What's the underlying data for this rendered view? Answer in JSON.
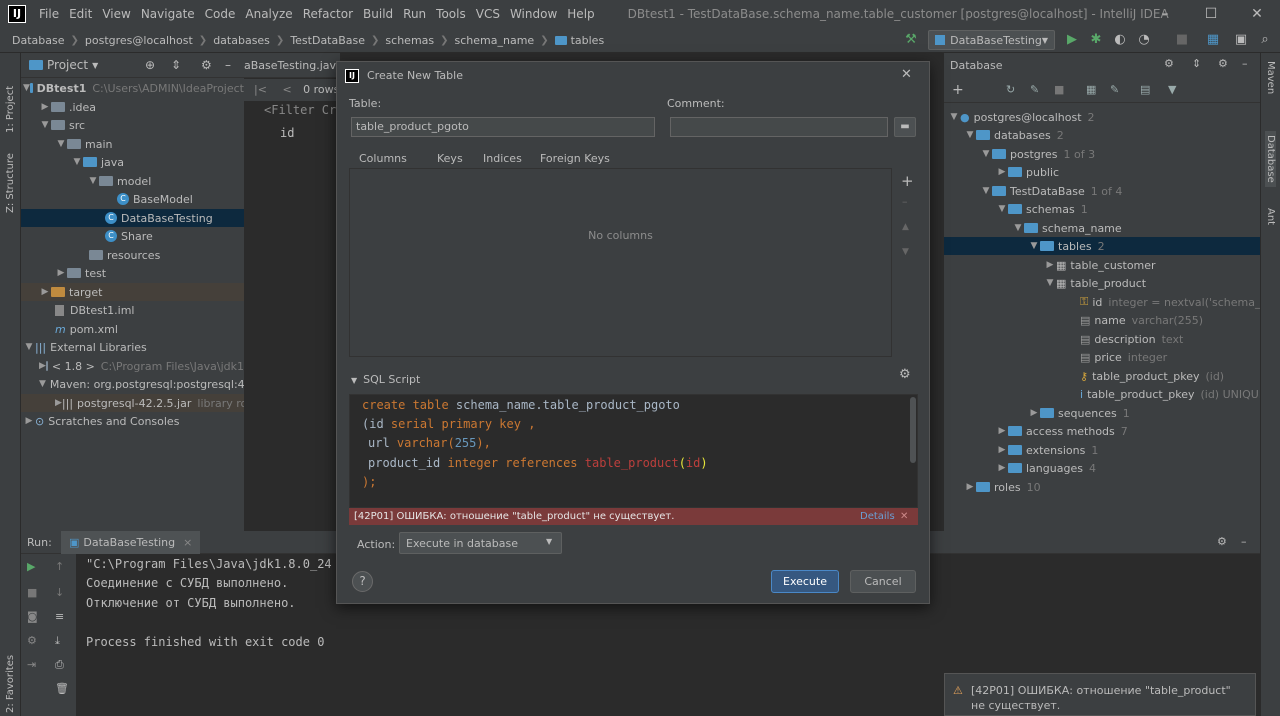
{
  "window": {
    "title": "DBtest1 - TestDataBase.schema_name.table_customer [postgres@localhost] - IntelliJ IDEA",
    "menu": [
      "File",
      "Edit",
      "View",
      "Navigate",
      "Code",
      "Analyze",
      "Refactor",
      "Build",
      "Run",
      "Tools",
      "VCS",
      "Window",
      "Help"
    ],
    "logo": "IJ"
  },
  "breadcrumbs": [
    "Database",
    "postgres@localhost",
    "databases",
    "TestDataBase",
    "schemas",
    "schema_name",
    "tables"
  ],
  "run_config": "DataBaseTesting",
  "left_tabs": {
    "project": "1: Project",
    "structure": "Z: Structure",
    "favorites": "2: Favorites"
  },
  "right_tabs": {
    "maven": "Maven",
    "database": "Database",
    "ant": "Ant"
  },
  "project": {
    "header": "Project",
    "rows": [
      {
        "label": "DBtest1",
        "extra": "C:\\Users\\ADMIN\\IdeaProject"
      },
      {
        "label": ".idea"
      },
      {
        "label": "src"
      },
      {
        "label": "main"
      },
      {
        "label": "java"
      },
      {
        "label": "model"
      },
      {
        "label": "BaseModel"
      },
      {
        "label": "DataBaseTesting"
      },
      {
        "label": "Share"
      },
      {
        "label": "resources"
      },
      {
        "label": "test"
      },
      {
        "label": "target"
      },
      {
        "label": "DBtest1.iml"
      },
      {
        "label": "pom.xml"
      },
      {
        "label": "External Libraries"
      },
      {
        "label": "< 1.8 >",
        "extra": "C:\\Program Files\\Java\\jdk1"
      },
      {
        "label": "Maven: org.postgresql:postgresql:4"
      },
      {
        "label": "postgresql-42.2.5.jar",
        "extra": "library roo"
      },
      {
        "label": "Scratches and Consoles"
      }
    ]
  },
  "editor": {
    "tab": "aBaseTesting.java",
    "rows": "0 rows",
    "filter": "<Filter Cr",
    "col": "id"
  },
  "database": {
    "header": "Database",
    "rows": [
      {
        "label": "postgres@localhost",
        "extra": "2"
      },
      {
        "label": "databases",
        "extra": "2"
      },
      {
        "label": "postgres",
        "extra": "1 of 3"
      },
      {
        "label": "public"
      },
      {
        "label": "TestDataBase",
        "extra": "1 of 4"
      },
      {
        "label": "schemas",
        "extra": "1"
      },
      {
        "label": "schema_name"
      },
      {
        "label": "tables",
        "extra": "2"
      },
      {
        "label": "table_customer"
      },
      {
        "label": "table_product"
      },
      {
        "label": "id",
        "extra": "integer = nextval('schema_na..."
      },
      {
        "label": "name",
        "extra": "varchar(255)"
      },
      {
        "label": "description",
        "extra": "text"
      },
      {
        "label": "price",
        "extra": "integer"
      },
      {
        "label": "table_product_pkey",
        "extra": "(id)"
      },
      {
        "label": "table_product_pkey",
        "extra": "(id) UNIQUE"
      },
      {
        "label": "sequences",
        "extra": "1"
      },
      {
        "label": "access methods",
        "extra": "7"
      },
      {
        "label": "extensions",
        "extra": "1"
      },
      {
        "label": "languages",
        "extra": "4"
      },
      {
        "label": "roles",
        "extra": "10"
      }
    ]
  },
  "run": {
    "label": "Run:",
    "tab": "DataBaseTesting",
    "lines": [
      "\"C:\\Program Files\\Java\\jdk1.8.0_24",
      "Соединение с СУБД выполнено.",
      "Отключение от СУБД выполнено.",
      "",
      "Process finished with exit code 0"
    ]
  },
  "dialog": {
    "title": "Create New Table",
    "table_label": "Table:",
    "table_value": "table_product_pgoto",
    "comment_label": "Comment:",
    "comment_value": "",
    "tabs": [
      "Columns",
      "Keys",
      "Indices",
      "Foreign Keys"
    ],
    "empty_text": "No columns",
    "sql_title": "SQL Script",
    "sql": {
      "l1_kw": "create table ",
      "l1_rest": "schema_name.table_product_pgoto",
      "l2_open": "(",
      "l2_col": "id ",
      "l2_kw": "serial primary key",
      "l2_end": " ,",
      "l3_col": "url ",
      "l3_kw": "varchar(",
      "l3_num": "255",
      "l3_end": "),",
      "l4_col": "product_id ",
      "l4_kw": "integer references ",
      "l4_tbl": "table_product",
      "l4_p1": "(",
      "l4_id": "id",
      "l4_p2": ")",
      "l5": ");"
    },
    "error": "[42P01] ОШИБКА: отношение \"table_product\" не существует.",
    "details": "Details",
    "action_label": "Action:",
    "action_value": "Execute in database",
    "execute": "Execute",
    "cancel": "Cancel",
    "help": "?"
  },
  "notification": {
    "line1": "[42P01] ОШИБКА: отношение \"table_product\"",
    "line2": "не существует."
  },
  "colors": {
    "accent": "#4e96c8",
    "selection": "#0d293e",
    "error": "#7a3a3a",
    "execute": "#365880"
  }
}
